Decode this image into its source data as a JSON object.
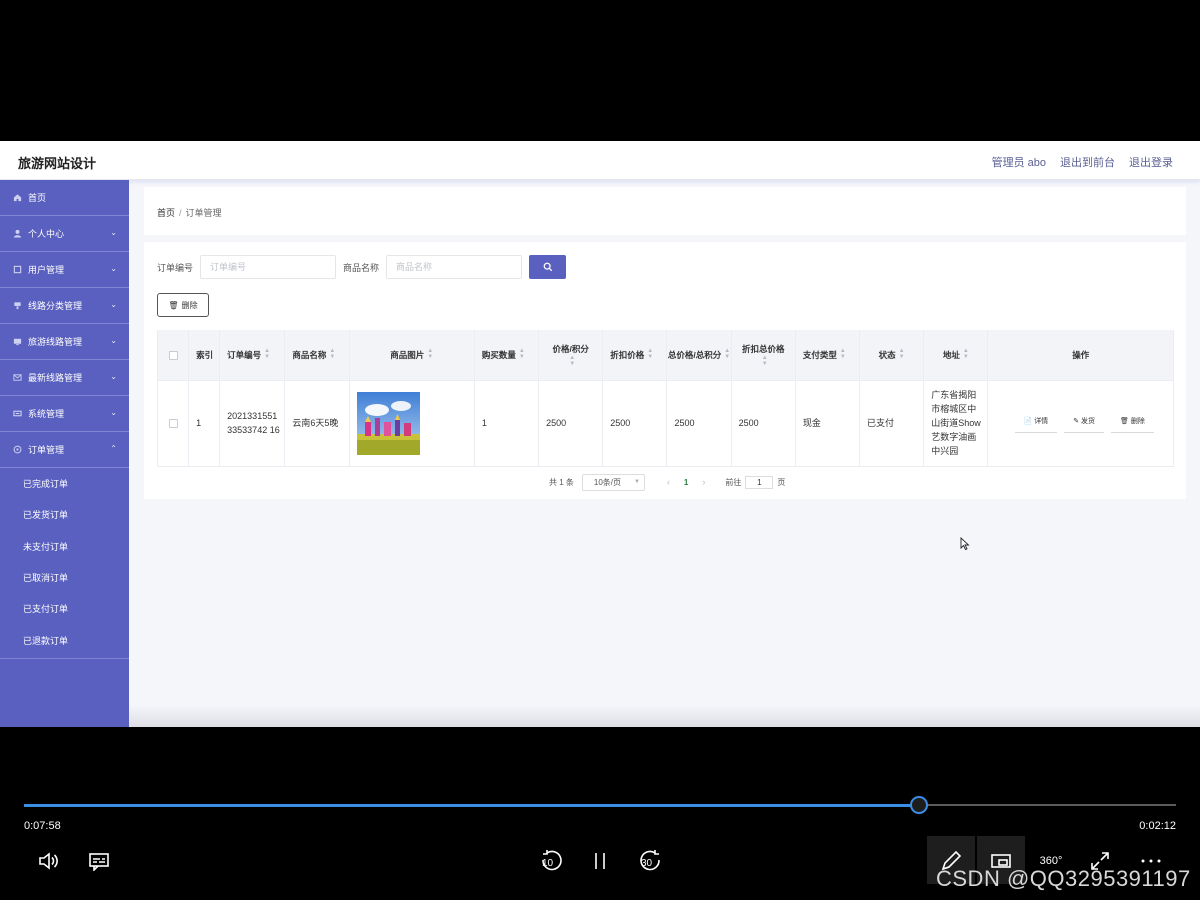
{
  "site": {
    "title": "旅游网站设计",
    "admin_label": "管理员 abo",
    "exit_front": "退出到前台",
    "logout": "退出登录"
  },
  "sidebar": {
    "items": [
      {
        "label": "首页",
        "icon": "home-icon"
      },
      {
        "label": "个人中心",
        "icon": "user-icon"
      },
      {
        "label": "用户管理",
        "icon": "users-icon"
      },
      {
        "label": "线路分类管理",
        "icon": "category-icon"
      },
      {
        "label": "旅游线路管理",
        "icon": "route-icon"
      },
      {
        "label": "最新线路管理",
        "icon": "mail-icon"
      },
      {
        "label": "系统管理",
        "icon": "system-icon"
      },
      {
        "label": "订单管理",
        "icon": "order-icon"
      }
    ],
    "order_sub": [
      "已完成订单",
      "已发货订单",
      "未支付订单",
      "已取消订单",
      "已支付订单",
      "已退款订单"
    ]
  },
  "breadcrumb": {
    "home": "首页",
    "sep": "/",
    "current": "订单管理"
  },
  "search": {
    "order_no_label": "订单编号",
    "order_no_placeholder": "订单编号",
    "product_label": "商品名称",
    "product_placeholder": "商品名称"
  },
  "toolbar": {
    "delete_label": "删除"
  },
  "table": {
    "headers": {
      "index": "索引",
      "order_no": "订单编号",
      "product_name": "商品名称",
      "product_image": "商品图片",
      "quantity": "购买数量",
      "price": "价格/积分",
      "discount_price": "折扣价格",
      "total": "总价格/总积分",
      "discount_total": "折扣总价格",
      "pay_type": "支付类型",
      "status": "状态",
      "address": "地址",
      "actions": "操作"
    },
    "rows": [
      {
        "index": "1",
        "order_no": "202133155133533742 16",
        "product_name": "云南6天5晚",
        "quantity": "1",
        "price": "2500",
        "discount_price": "2500",
        "total": "2500",
        "discount_total": "2500",
        "pay_type": "现金",
        "status": "已支付",
        "address": "广东省揭阳市榕城区中山街道Show艺数字油画中兴园",
        "actions": {
          "detail": "详情",
          "ship": "发货",
          "delete": "删除"
        }
      }
    ]
  },
  "pagination": {
    "total": "共 1 条",
    "page_size": "10条/页",
    "current_page": "1",
    "goto_label": "前往",
    "goto_value": "1",
    "page_suffix": "页"
  },
  "player": {
    "elapsed": "0:07:58",
    "remaining": "0:02:12",
    "progress": 0.777,
    "rewind_label": "10",
    "forward_label": "30",
    "vr_label": "360°",
    "watermark": "CSDN @QQ3295391197",
    "accent": "#3a8ee6"
  },
  "colors": {
    "sidebar": "#5a60bf",
    "primary": "#5a60bf"
  }
}
